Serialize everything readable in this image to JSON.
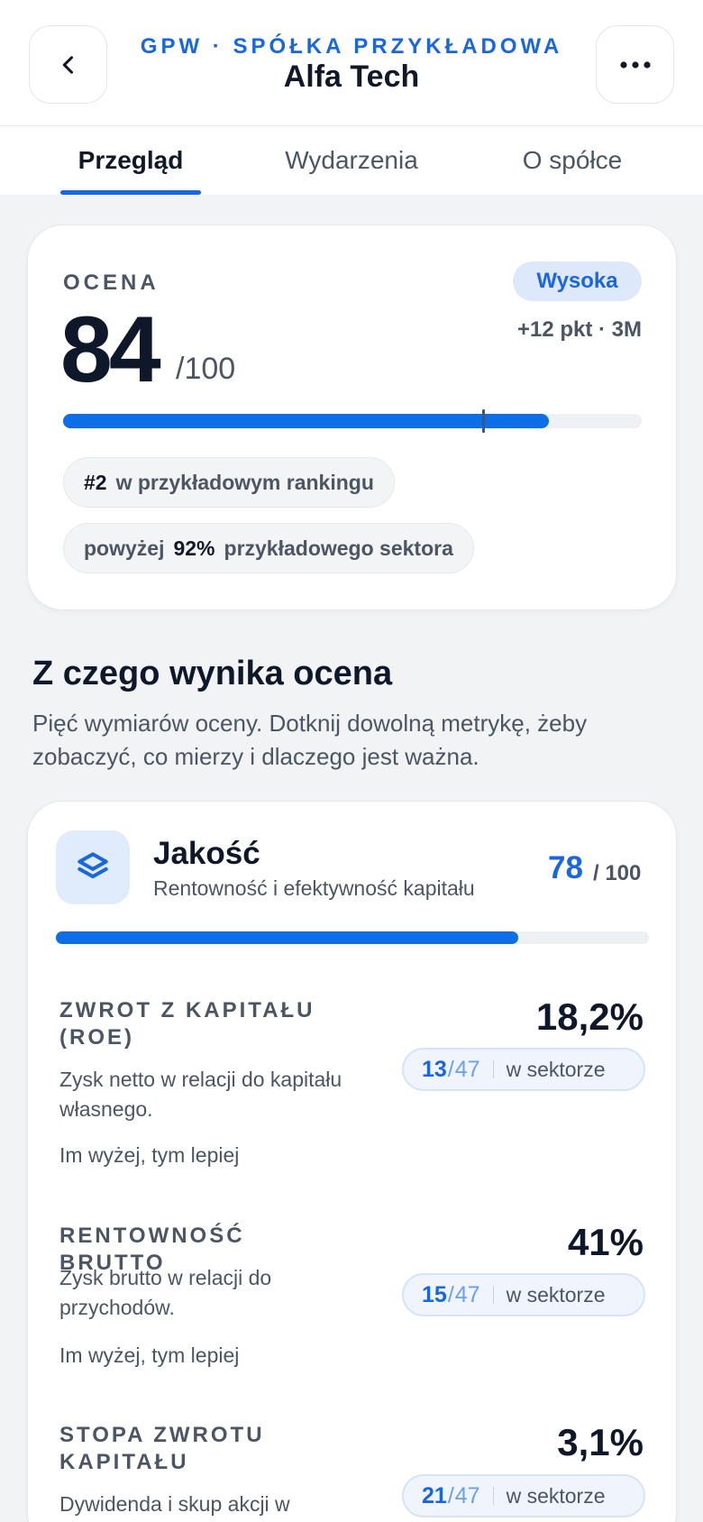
{
  "header": {
    "kicker": "GPW · SPÓŁKA PRZYKŁADOWA",
    "title": "Alfa Tech",
    "back_icon": "chevron-left-icon",
    "more_icon": "more-horizontal-icon"
  },
  "tabs": [
    {
      "label": "Przegląd",
      "active": true
    },
    {
      "label": "Wydarzenia",
      "active": false
    },
    {
      "label": "O spółce",
      "active": false
    }
  ],
  "score": {
    "label": "OCENA",
    "value": "84",
    "max": "/100",
    "badge": "Wysoka",
    "delta": "+12 pkt · 3M",
    "progress": 0.84,
    "marker": 0.725,
    "rank_prefix": "#2",
    "rank_text": "w przykładowym rankingu",
    "percentile_prefix": "powyżej",
    "percentile_value": "92%",
    "percentile_suffix": "przykładowego sektora"
  },
  "section": {
    "title": "Z czego wynika ocena",
    "description": "Pięć wymiarów oceny. Dotknij dowolną metrykę, żeby zobaczyć, co mierzy i dlaczego jest ważna."
  },
  "dimension": {
    "icon": "layers-icon",
    "title": "Jakość",
    "subtitle": "Rentowność i efektywność kapitału",
    "score": "78",
    "max": "/ 100",
    "progress": 0.78
  },
  "metrics": [
    {
      "name": "ZWROT Z KAPITAŁU (ROE)",
      "description": "Zysk netto w relacji do kapitału własnego.",
      "direction": "Im wyżej, tym lepiej",
      "value": "18,2%",
      "rank": "13",
      "total": "47",
      "rank_suffix": "w sektorze"
    },
    {
      "name": "RENTOWNOŚĆ BRUTTO",
      "description": "Zysk brutto w relacji do przychodów.",
      "direction": "Im wyżej, tym lepiej",
      "value": "41%",
      "rank": "15",
      "total": "47",
      "rank_suffix": "w sektorze"
    },
    {
      "name": "STOPA ZWROTU KAPITAŁU",
      "description": "Dywidenda i skup akcji w",
      "direction": "",
      "value": "3,1%",
      "rank": "21",
      "total": "47",
      "rank_suffix": "w sektorze"
    }
  ],
  "colors": {
    "accent": "#1a66e0",
    "bar": "#0d6ee8",
    "background": "#f2f3f5"
  }
}
